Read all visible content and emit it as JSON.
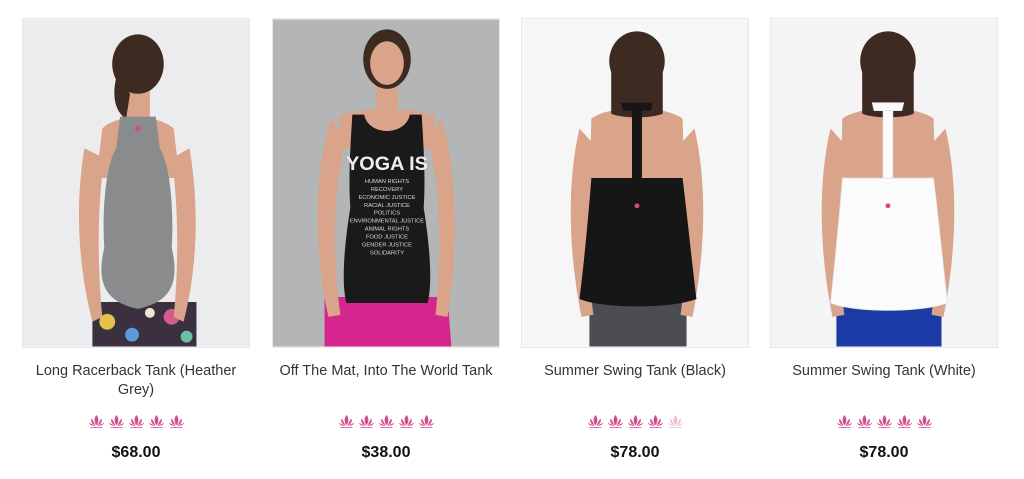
{
  "products": [
    {
      "title": "Long Racerback Tank (Heather Grey)",
      "rating": 5,
      "price": "$68.00",
      "image": "woman-back-grey-racerback-tank",
      "bg_color": "#ececee",
      "tank_color": "#8a8b8d",
      "pants_color": "#3a3040"
    },
    {
      "title": "Off The Mat, Into The World Tank",
      "rating": 5,
      "price": "$38.00",
      "image": "woman-front-black-yoga-is-tank",
      "bg_color": "#b3b5b7",
      "tank_color": "#1a1a1a",
      "pants_color": "#d5258f",
      "graphic": {
        "headline": "YOGA IS",
        "lines": [
          "HUMAN RIGHTS",
          "RECOVERY",
          "ECONOMIC JUSTICE",
          "RACIAL JUSTICE",
          "POLITICS",
          "ENVIRONMENTAL JUSTICE",
          "ANIMAL RIGHTS",
          "FOOD JUSTICE",
          "GENDER JUSTICE",
          "SOLIDARITY"
        ]
      }
    },
    {
      "title": "Summer Swing Tank (Black)",
      "rating": 4.5,
      "price": "$78.00",
      "image": "woman-back-black-swing-tank",
      "bg_color": "#f6f6f6",
      "tank_color": "#161616",
      "pants_color": "#4b4d52"
    },
    {
      "title": "Summer Swing Tank (White)",
      "rating": 5,
      "price": "$78.00",
      "image": "woman-back-white-swing-tank",
      "bg_color": "#f4f4f4",
      "tank_color": "#fbfbfb",
      "pants_color": "#1c3aa5"
    }
  ],
  "colors": {
    "rating_full": "#d2498c",
    "rating_empty": "#efbcd5",
    "skin": "#d9a48a",
    "hair": "#3d2a20"
  },
  "icons": {
    "rating": "lotus-icon"
  }
}
